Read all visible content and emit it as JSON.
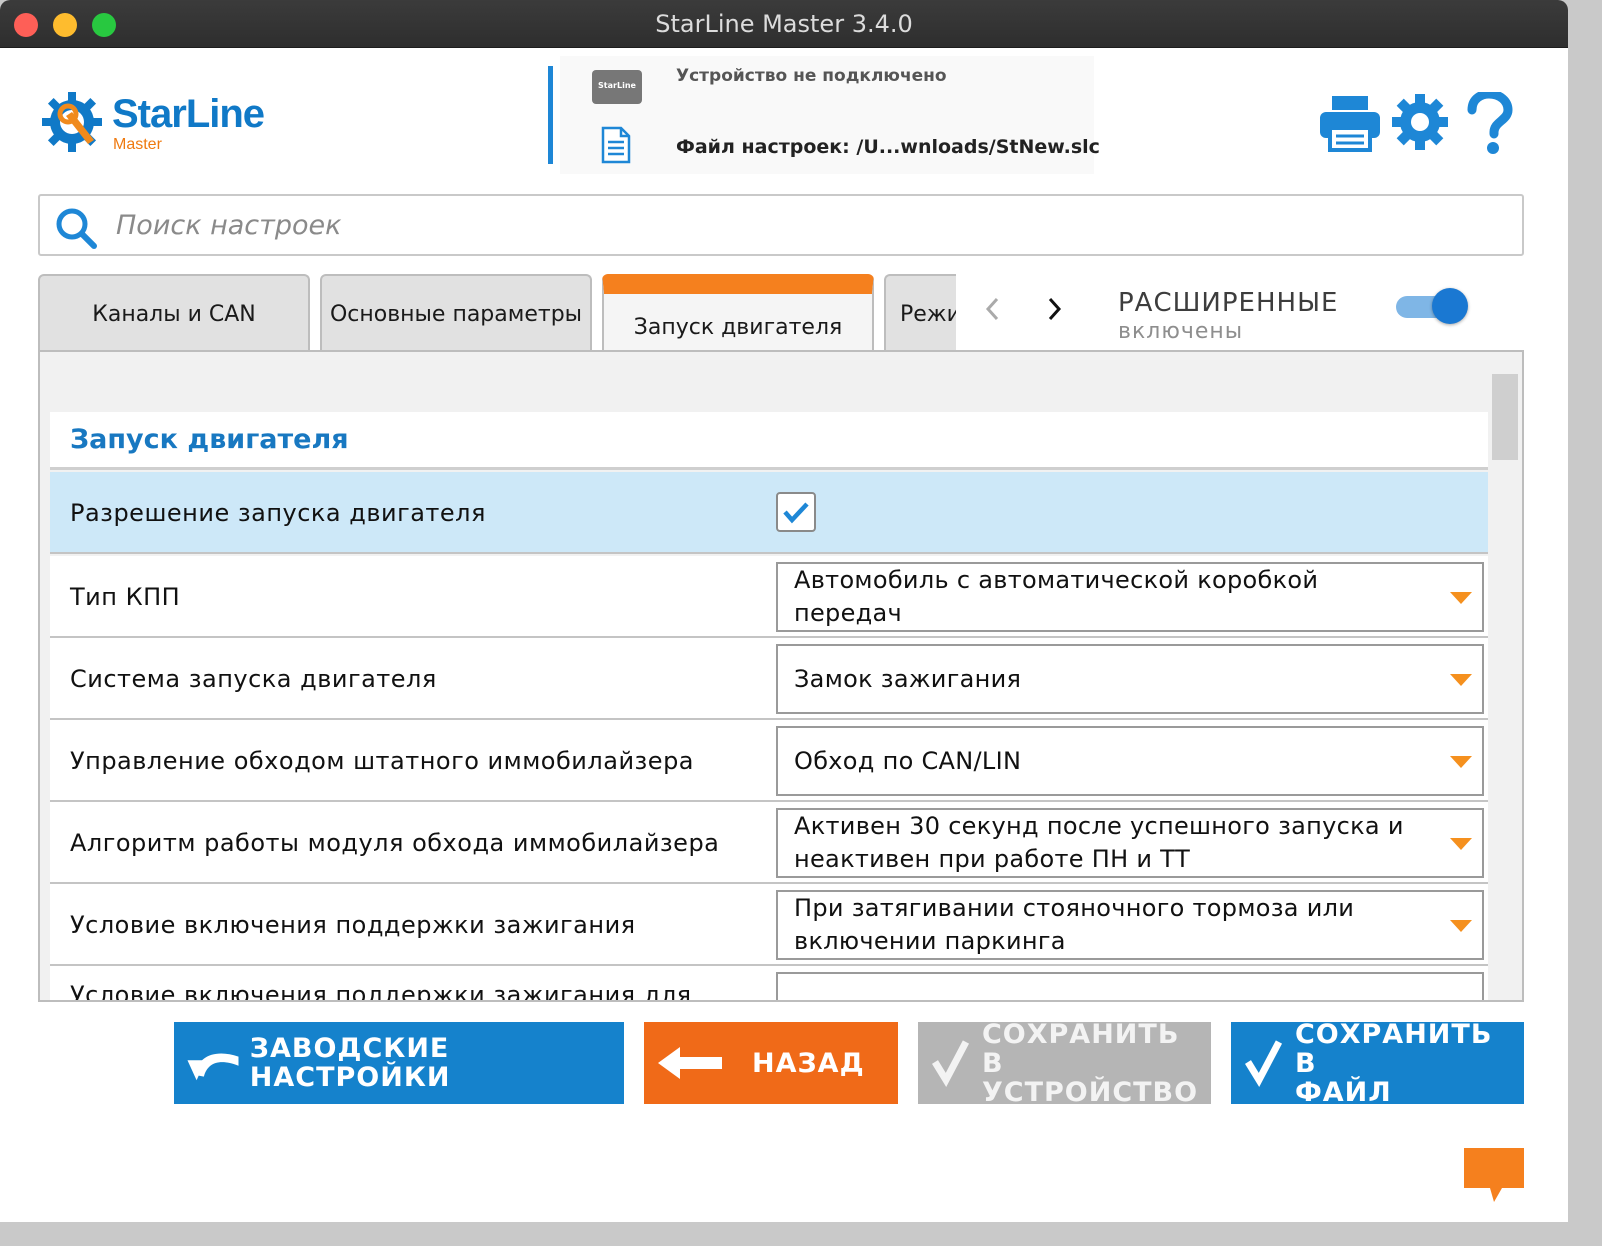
{
  "window": {
    "title": "StarLine Master 3.4.0"
  },
  "logo": {
    "word": "StarLine",
    "sub": "Master"
  },
  "status": {
    "device_icon_label": "StarLine",
    "device": "Устройство не подключено",
    "file": "Файл настроек: /U...wnloads/StNew.slc"
  },
  "header_icons": [
    "printer-icon",
    "gear-icon",
    "help-icon"
  ],
  "search": {
    "placeholder": "Поиск настроек",
    "value": ""
  },
  "tabs": [
    {
      "label": "Каналы и CAN",
      "active": false
    },
    {
      "label": "Основные параметры",
      "active": false
    },
    {
      "label": "Запуск двигателя",
      "active": true
    },
    {
      "label": "Режи",
      "active": false
    }
  ],
  "advanced": {
    "title": "РАСШИРЕННЫЕ",
    "subtitle": "включены",
    "enabled": true
  },
  "section": {
    "title": "Запуск двигателя"
  },
  "rows": [
    {
      "label": "Разрешение запуска двигателя",
      "type": "checkbox",
      "checked": true
    },
    {
      "label": "Тип КПП",
      "value": "Автомобиль с автоматической коробкой передач"
    },
    {
      "label": "Система запуска двигателя",
      "value": "Замок зажигания"
    },
    {
      "label": "Управление обходом штатного иммобилайзера",
      "value": "Обход по CAN/LIN"
    },
    {
      "label": "Алгоритм работы модуля обхода иммобилайзера",
      "value": "Активен 30 секунд после успешного запуска и неактивен при работе ПН и ТТ"
    },
    {
      "label": "Условие включения поддержки зажигания",
      "value": "При затягивании стояночного тормоза или включении паркинга"
    },
    {
      "label": "Условие включения поддержки зажигания для",
      "value": ""
    }
  ],
  "buttons": {
    "factory": "ЗАВОДСКИЕ НАСТРОЙКИ",
    "back": "НАЗАД",
    "save_device_1": "СОХРАНИТЬ В",
    "save_device_2": "УСТРОЙСТВО",
    "save_file_1": "СОХРАНИТЬ В",
    "save_file_2": "ФАЙЛ"
  },
  "colors": {
    "accent_blue": "#1582cc",
    "accent_orange": "#f06a18",
    "selected_row": "#cde8f8",
    "disabled": "#b5b5b5"
  }
}
